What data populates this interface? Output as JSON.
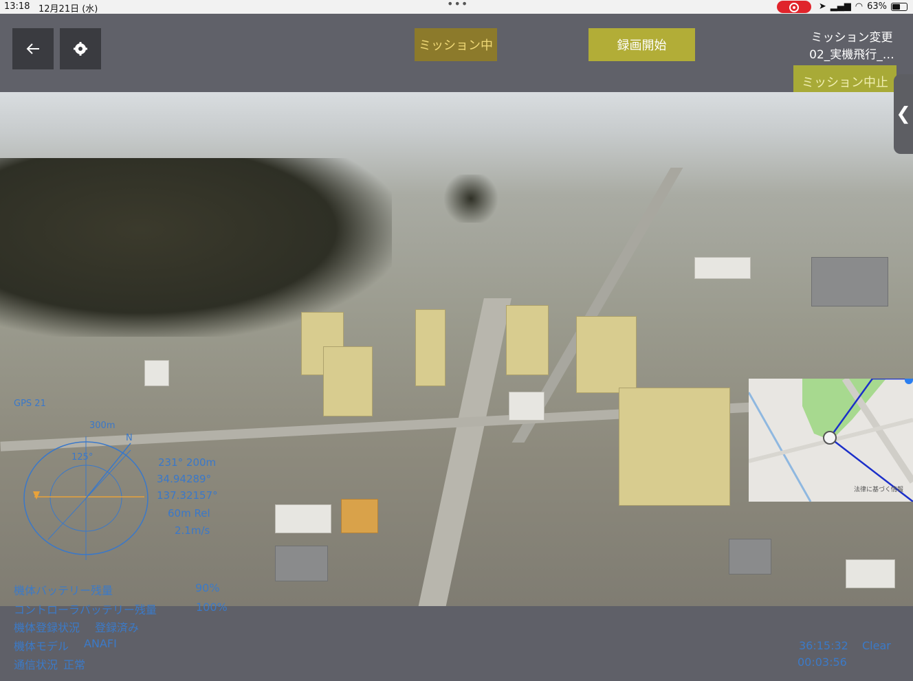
{
  "status_bar": {
    "time": "13:18",
    "date": "12月21日 (水)",
    "battery_percent": "63%",
    "battery_level": 0.63
  },
  "toolbar": {
    "back_icon": "arrow-left-icon",
    "settings_icon": "gear-icon",
    "mission_status": "ミッション中",
    "record_button": "録画開始",
    "mission_change_label": "ミッション変更",
    "mission_name": "02_実機飛行_…",
    "mission_abort_button": "ミッション中止"
  },
  "side_tab": {
    "icon": "chevron-left-icon",
    "glyph": "❮"
  },
  "minimap": {
    "credit": "法律に基づく情報"
  },
  "hud": {
    "gps": "GPS 21",
    "distance": "300m",
    "north": "N",
    "heading": "125°",
    "bearing_range": "231°  200m",
    "latitude": "34.94289°",
    "longitude": "137.32157°",
    "altitude": "60m Rel",
    "speed": "2.1m/s"
  },
  "telemetry": {
    "aircraft_battery_label": "機体バッテリー残量",
    "aircraft_battery_value": "90%",
    "controller_battery_label": "コントローラバッテリー残量",
    "controller_battery_value": "100%",
    "registration_label": "機体登録状況",
    "registration_value": "登録済み",
    "model_label": "機体モデル",
    "model_value": "ANAFI",
    "comm_label": "通信状況",
    "comm_value": "正常",
    "flight_time": "36:15:32",
    "weather": "Clear",
    "timer": "00:03:56"
  },
  "colors": {
    "toolbar_bg": "#606169",
    "mission_status_bg": "#8c7a2b",
    "record_bg": "#b2ad37",
    "abort_bg": "#a8aa37",
    "hud_blue": "#3a78c9",
    "route_blue": "#1b2fc9"
  }
}
